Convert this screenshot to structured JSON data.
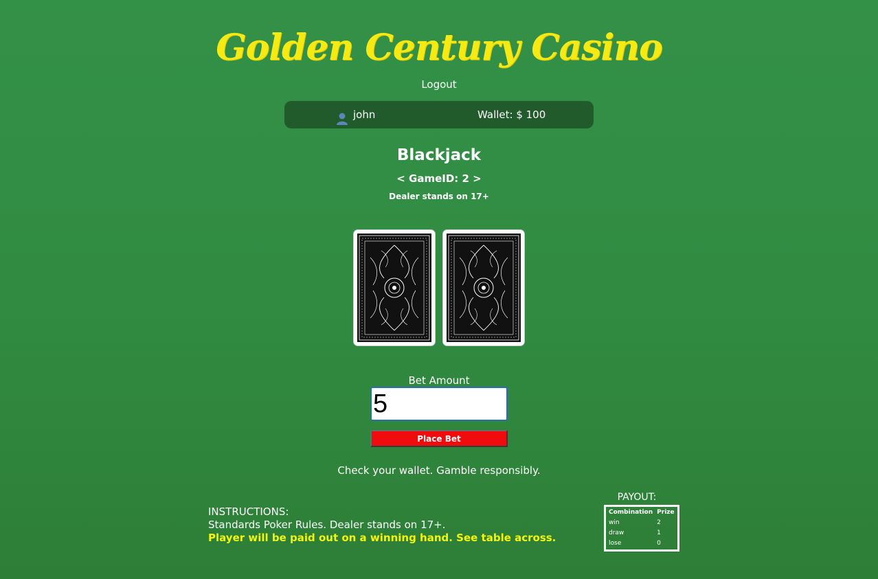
{
  "header": {
    "title": "Golden Century Casino",
    "logout_label": "Logout"
  },
  "userbar": {
    "user_icon": "user-icon",
    "username": "john",
    "wallet": "Wallet: $ 100"
  },
  "game": {
    "name": "Blackjack",
    "game_id": "< GameID: 2 >",
    "rule": "Dealer stands on 17+",
    "cards": [
      {
        "face": "back"
      },
      {
        "face": "back"
      }
    ]
  },
  "bet": {
    "label": "Bet Amount",
    "value": "5",
    "button_label": "Place Bet"
  },
  "notice": "Check your wallet. Gamble responsibly.",
  "instructions": {
    "heading": "INSTRUCTIONS:",
    "line1": "Standards Poker Rules. Dealer stands on 17+.",
    "line2": "Player will be paid out on a winning hand. See table across."
  },
  "payout": {
    "title": "PAYOUT:",
    "headers": [
      "Combination",
      "Prize"
    ],
    "rows": [
      [
        "win",
        "2"
      ],
      [
        "draw",
        "1"
      ],
      [
        "lose",
        "0"
      ]
    ]
  },
  "colors": {
    "background": "#318c42",
    "title": "#f5ea14",
    "userbar": "#215a2b",
    "button": "#f00c0c",
    "highlight": "#f5f50a"
  }
}
